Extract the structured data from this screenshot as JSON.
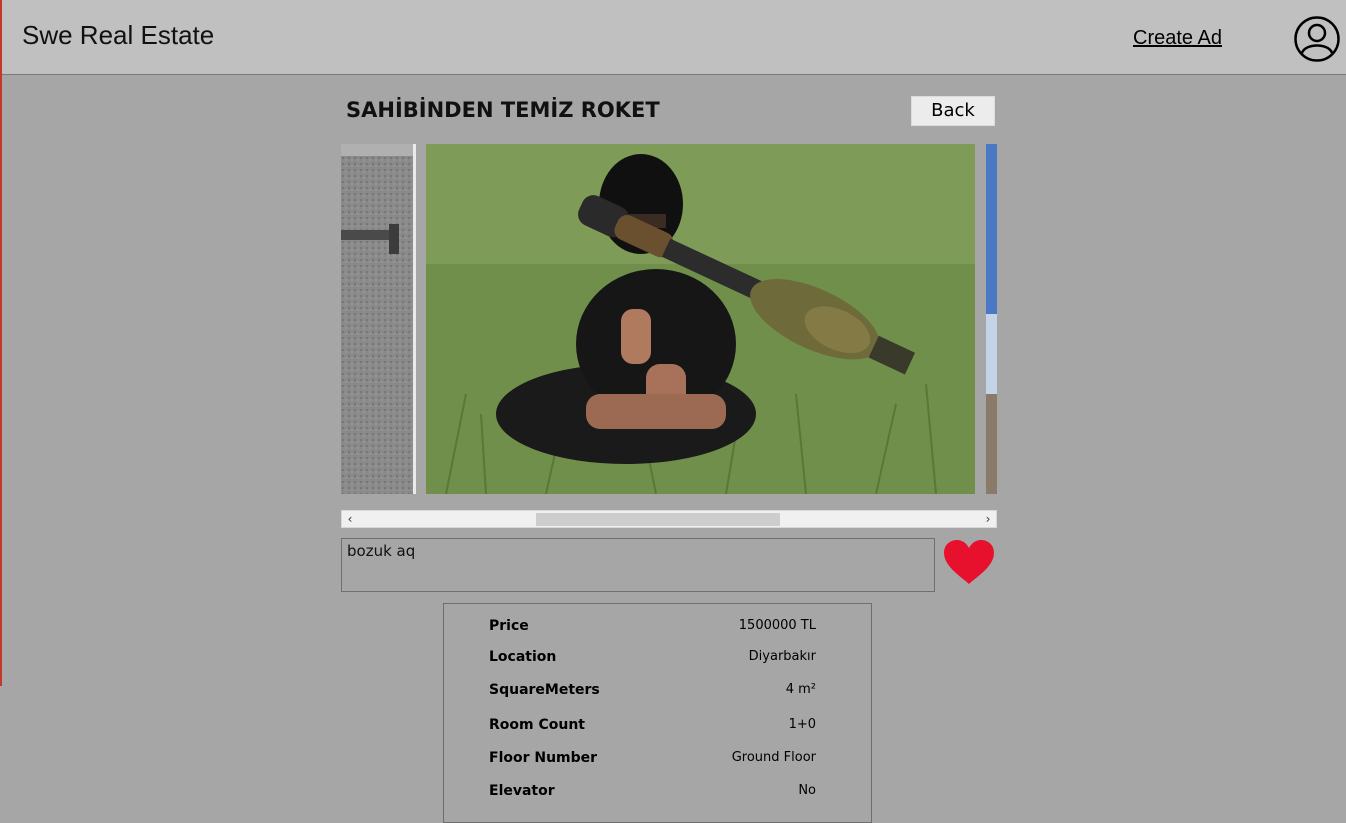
{
  "header": {
    "app_title": "Swe Real Estate",
    "create_ad_label": "Create Ad",
    "profile_icon": "user-circle-icon"
  },
  "ad": {
    "title": "SAHİBİNDEN TEMİZ ROKET",
    "back_label": "Back",
    "description": "bozuk aq",
    "favorite_icon": "heart-icon",
    "favorite_color": "#e8112d"
  },
  "gallery": {
    "scroll_left_glyph": "‹",
    "scroll_right_glyph": "›"
  },
  "details": [
    {
      "label": "Price",
      "value": "1500000 TL"
    },
    {
      "label": "Location",
      "value": "Diyarbakır"
    },
    {
      "label": "SquareMeters",
      "value": "4 m²"
    },
    {
      "label": "Room Count",
      "value": "1+0"
    },
    {
      "label": "Floor Number",
      "value": "Ground Floor"
    },
    {
      "label": "Elevator",
      "value": "No"
    }
  ]
}
